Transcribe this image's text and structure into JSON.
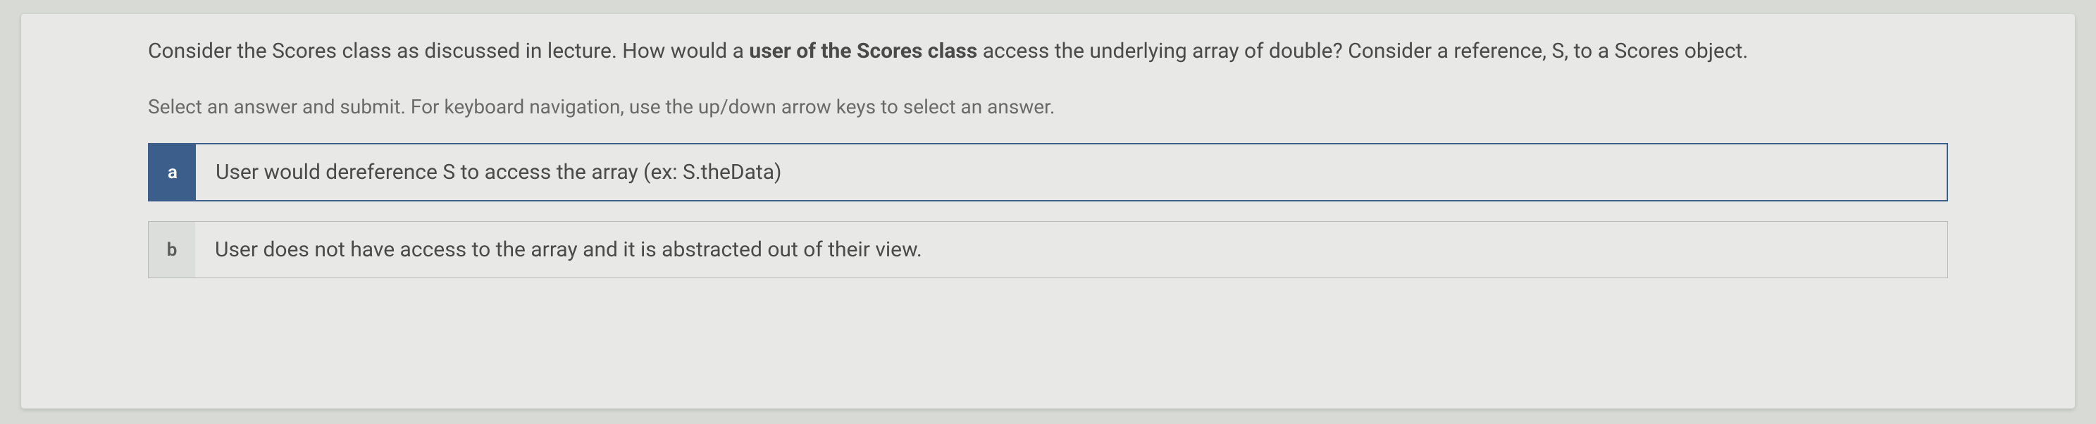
{
  "question": {
    "part1": "Consider the Scores class as discussed in lecture.  How would a ",
    "bold": "user of the Scores class",
    "part2": " access the underlying array of double?  Consider a reference, S, to a Scores object."
  },
  "instruction": "Select an answer and submit. For keyboard navigation, use the up/down arrow keys to select an answer.",
  "options": {
    "a": {
      "key": "a",
      "text": "User would dereference S to access the array (ex: S.theData)",
      "selected": true
    },
    "b": {
      "key": "b",
      "text": "User does not have access to the array and it is abstracted out of their view.",
      "selected": false
    }
  }
}
